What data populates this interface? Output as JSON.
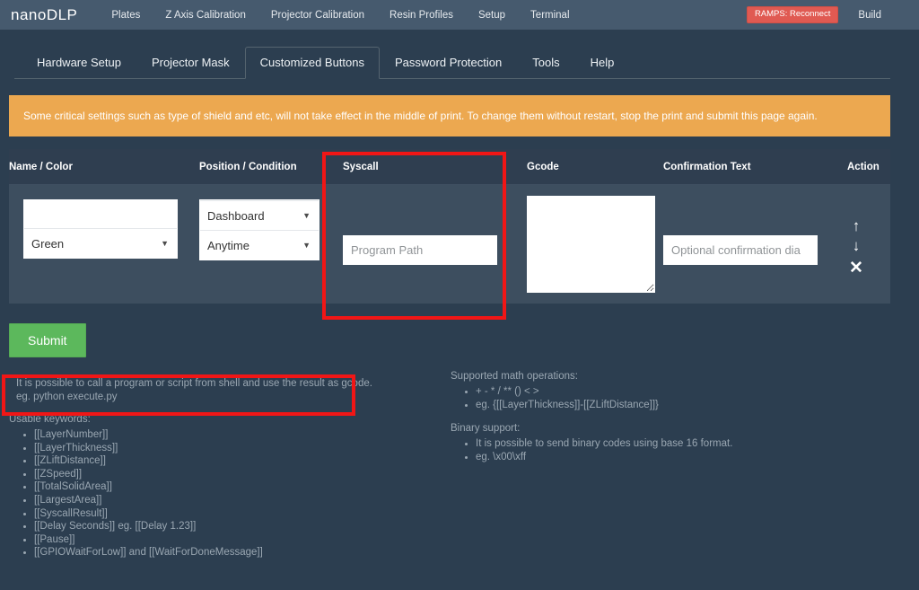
{
  "topnav": {
    "brand": "nanoDLP",
    "links": [
      {
        "label": "Plates"
      },
      {
        "label": "Z Axis Calibration"
      },
      {
        "label": "Projector Calibration"
      },
      {
        "label": "Resin Profiles"
      },
      {
        "label": "Setup"
      },
      {
        "label": "Terminal"
      }
    ],
    "status_badge": "RAMPS: Reconnect",
    "status_badge_color": "#e05a52",
    "build_label": "Build"
  },
  "tabs": [
    {
      "label": "Hardware Setup",
      "active": false
    },
    {
      "label": "Projector Mask",
      "active": false
    },
    {
      "label": "Customized Buttons",
      "active": true
    },
    {
      "label": "Password Protection",
      "active": false
    },
    {
      "label": "Tools",
      "active": false
    },
    {
      "label": "Help",
      "active": false
    }
  ],
  "warning": {
    "text": "Some critical settings such as type of shield and etc, will not take effect in the middle of print. To change them without restart, stop the print and submit this page again.",
    "background": "#eca850"
  },
  "table": {
    "headers": {
      "name_color": "Name / Color",
      "position_condition": "Position / Condition",
      "syscall": "Syscall",
      "gcode": "Gcode",
      "confirmation_text": "Confirmation Text",
      "action": "Action"
    },
    "row": {
      "name_value": "",
      "name_placeholder": "",
      "color_value": "Green",
      "position_value": "Dashboard",
      "condition_value": "Anytime",
      "syscall_value": "",
      "syscall_placeholder": "Program Path",
      "gcode_value": "",
      "confirmation_value": "",
      "confirmation_placeholder": "Optional confirmation dia",
      "action_up": "↑",
      "action_down": "↓",
      "action_delete": "✕"
    }
  },
  "submit": {
    "label": "Submit",
    "color": "#5cb85c"
  },
  "help": {
    "syscall_note_line1": "It is possible to call a program or script from shell and use the result as gcode.",
    "syscall_note_line2": "eg. python execute.py",
    "keywords_title": "Usable keywords:",
    "keywords": [
      "[[LayerNumber]]",
      "[[LayerThickness]]",
      "[[ZLiftDistance]]",
      "[[ZSpeed]]",
      "[[TotalSolidArea]]",
      "[[LargestArea]]",
      "[[SyscallResult]]",
      "[[Delay Seconds]] eg. [[Delay 1.23]]",
      "[[Pause]]",
      "[[GPIOWaitForLow]] and [[WaitForDoneMessage]]"
    ],
    "math_title": "Supported math operations:",
    "math_items": [
      "+ - * / ** () < >",
      "eg. {[[LayerThickness]]-[[ZLiftDistance]]}"
    ],
    "binary_title": "Binary support:",
    "binary_items": [
      "It is possible to send binary codes using base 16 format.",
      "eg. \\x00\\xff"
    ]
  },
  "annotations": {
    "syscall_highlight_color": "#f11616",
    "note_highlight_color": "#f11616"
  }
}
